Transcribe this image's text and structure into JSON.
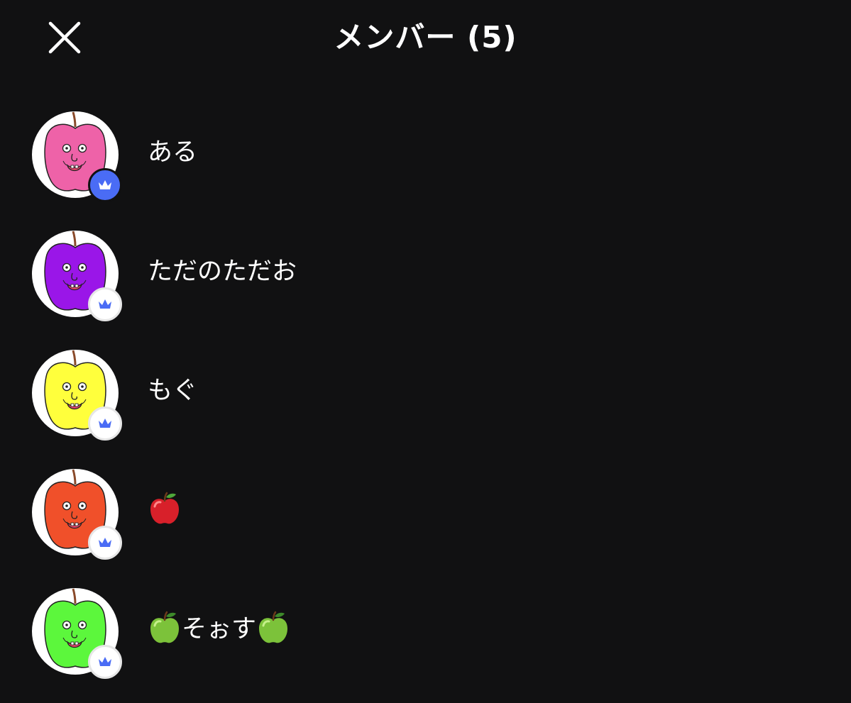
{
  "header": {
    "title": "メンバー (5)",
    "close_icon": "close-icon"
  },
  "members": [
    {
      "name": "ある",
      "apple_color": "#EE62A8",
      "badge": "crown-icon",
      "badge_filled": true
    },
    {
      "name": "ただのただお",
      "apple_color": "#9A16E8",
      "badge": "crown-icon",
      "badge_filled": false
    },
    {
      "name": "もぐ",
      "apple_color": "#FFFF3C",
      "badge": "crown-icon",
      "badge_filled": false
    },
    {
      "name": "",
      "name_emoji": "red-apple-emoji",
      "apple_color": "#F0502A",
      "badge": "crown-icon",
      "badge_filled": false
    },
    {
      "name": "そぉす",
      "name_emoji": "green-apple-emoji",
      "apple_color": "#5CF73C",
      "badge": "crown-icon",
      "badge_filled": false
    }
  ],
  "colors": {
    "background": "#111112",
    "badge_blue": "#4A6CF5",
    "text": "#FFFFFF"
  }
}
